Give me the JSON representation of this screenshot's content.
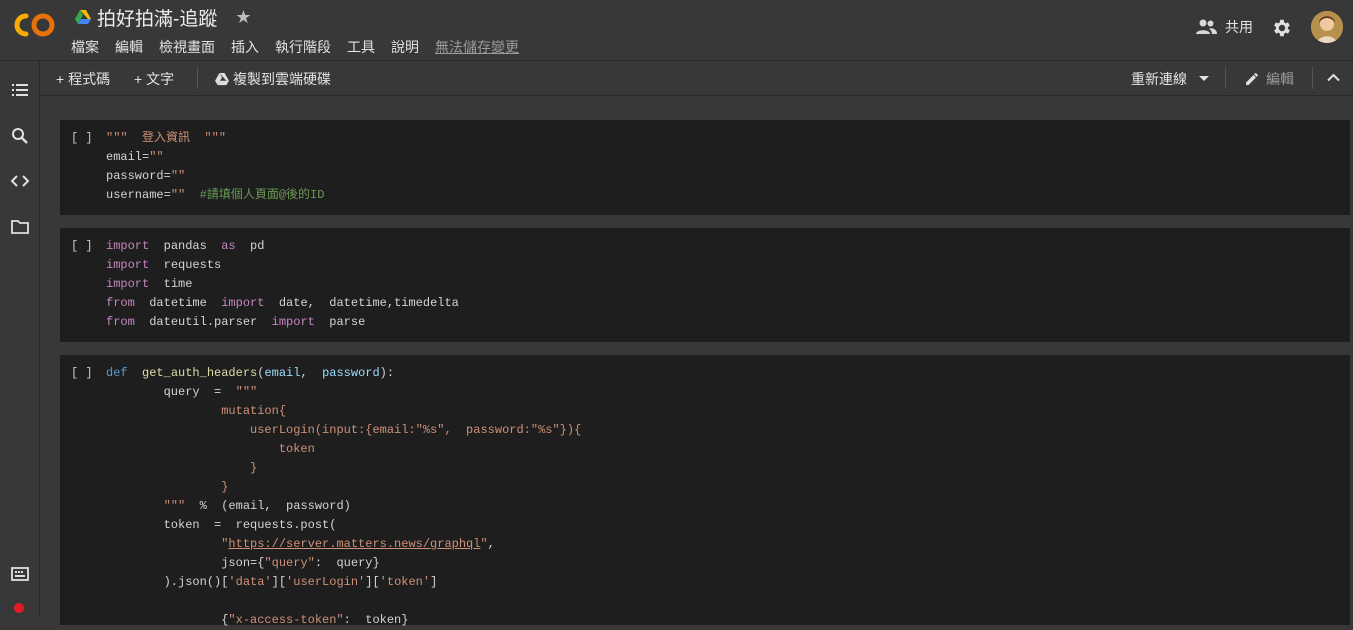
{
  "header": {
    "doc_title": "拍好拍滿-追蹤",
    "menu": [
      "檔案",
      "編輯",
      "檢視畫面",
      "插入",
      "執行階段",
      "工具",
      "說明"
    ],
    "unsaved_label": "無法儲存變更",
    "share_label": "共用"
  },
  "toolbar": {
    "add_code": "+ 程式碼",
    "add_text": "+ 文字",
    "copy_to_drive": "複製到雲端硬碟",
    "reconnect": "重新連線",
    "edit": "編輯"
  },
  "cells": [
    {
      "indicator": "[ ]",
      "lines": [
        "\"\"\"  登入資訊  \"\"\"",
        "email=\"\"",
        "password=\"\"",
        "username=\"\"  #請填個人頁面@後的ID"
      ]
    },
    {
      "indicator": "[ ]",
      "lines": [
        "import  pandas  as  pd",
        "import  requests",
        "import  time",
        "from  datetime  import  date,  datetime,timedelta",
        "from  dateutil.parser  import  parse"
      ]
    },
    {
      "indicator": "[ ]",
      "lines": [
        "def  get_auth_headers(email,  password):",
        "        query  =  \"\"\"",
        "                mutation{",
        "                    userLogin(input:{email:\"%s\",  password:\"%s\"}){",
        "                        token",
        "                    }",
        "                }",
        "        \"\"\"  %  (email,  password)",
        "        token  =  requests.post(",
        "                \"https://server.matters.news/graphql\",",
        "                json={\"query\":  query}",
        "        ).json()['data']['userLogin']['token']",
        "",
        "                {\"x-access-token\":  token}"
      ]
    }
  ]
}
